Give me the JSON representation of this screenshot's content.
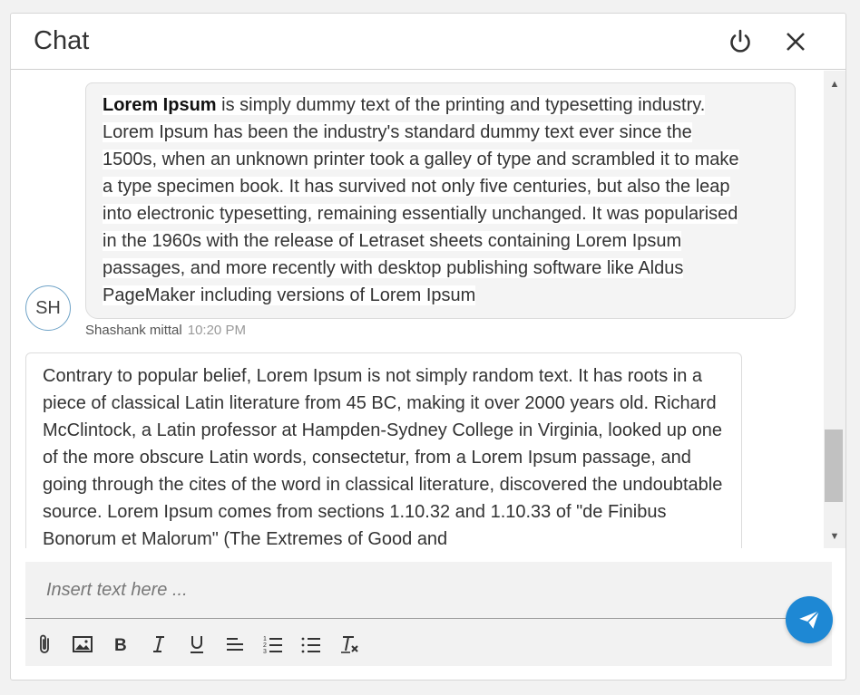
{
  "header": {
    "title": "Chat",
    "power_icon": "power-icon",
    "close_icon": "close-icon"
  },
  "messages": [
    {
      "lead": "Lorem Ipsum",
      "lines": [
        " is simply dummy text of the printing and typesetting industry.",
        "Lorem Ipsum has been the industry's standard dummy text ever since the",
        "1500s, when an unknown printer took a galley of type and scrambled it to make",
        "a type specimen book. It has survived not only five centuries, but also the leap",
        "into electronic typesetting, remaining essentially unchanged. It was popularised",
        "in the 1960s with the release of Letraset sheets containing Lorem Ipsum",
        "passages, and more recently with desktop publishing software like Aldus",
        "PageMaker including versions of Lorem Ipsum"
      ],
      "author_initials": "SH",
      "author": "Shashank mittal",
      "time": "10:20 PM"
    },
    {
      "text": "Contrary to popular belief, Lorem Ipsum is not simply random text. It has roots in a piece of classical Latin literature from 45 BC, making it over 2000 years old. Richard McClintock, a Latin professor at Hampden-Sydney College in Virginia, looked up one of the more obscure Latin words, consectetur, from a Lorem Ipsum passage, and going through the cites of the word in classical literature, discovered the undoubtable source. Lorem Ipsum comes from sections 1.10.32 and 1.10.33 of \"de Finibus Bonorum et Malorum\" (The Extremes of Good and"
    }
  ],
  "composer": {
    "placeholder": "Insert text here ...",
    "tools": [
      "attach-icon",
      "image-icon",
      "bold-icon",
      "italic-icon",
      "underline-icon",
      "align-left-icon",
      "ordered-list-icon",
      "unordered-list-icon",
      "clear-format-icon"
    ],
    "send_icon": "send-icon"
  },
  "colors": {
    "accent": "#1e88d4",
    "avatar_border": "#6fa3c7"
  }
}
